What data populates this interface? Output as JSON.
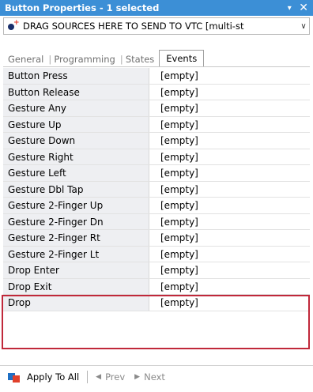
{
  "window": {
    "title": "Button Properties - 1 selected",
    "pin_glyph": "▾",
    "close_glyph": "✕"
  },
  "drop_target": {
    "text": "DRAG SOURCES HERE TO SEND TO VTC  [multi-st",
    "chevron_glyph": "∨",
    "icon": "drag-source-dot-icon"
  },
  "tabs": [
    {
      "label": "General",
      "active": false
    },
    {
      "label": "Programming",
      "active": false
    },
    {
      "label": "States",
      "active": false
    },
    {
      "label": "Events",
      "active": true
    }
  ],
  "tab_separator": "|",
  "events": [
    {
      "name": "Button Press",
      "value": "[empty]"
    },
    {
      "name": "Button Release",
      "value": "[empty]"
    },
    {
      "name": "Gesture Any",
      "value": "[empty]"
    },
    {
      "name": "Gesture Up",
      "value": "[empty]"
    },
    {
      "name": "Gesture Down",
      "value": "[empty]"
    },
    {
      "name": "Gesture Right",
      "value": "[empty]"
    },
    {
      "name": "Gesture Left",
      "value": "[empty]"
    },
    {
      "name": "Gesture Dbl Tap",
      "value": "[empty]"
    },
    {
      "name": "Gesture 2-Finger Up",
      "value": "[empty]"
    },
    {
      "name": "Gesture 2-Finger Dn",
      "value": "[empty]"
    },
    {
      "name": "Gesture 2-Finger Rt",
      "value": "[empty]"
    },
    {
      "name": "Gesture 2-Finger Lt",
      "value": "[empty]"
    },
    {
      "name": "Drop Enter",
      "value": "[empty]"
    },
    {
      "name": "Drop Exit",
      "value": "[empty]"
    },
    {
      "name": "Drop",
      "value": "[empty]"
    }
  ],
  "footer": {
    "apply_label": "Apply To All",
    "prev_label": "Prev",
    "next_label": "Next",
    "prev_glyph": "◀",
    "next_glyph": "▶"
  },
  "colors": {
    "title_bar": "#3c8fd6",
    "highlight_border": "#c0283a"
  }
}
